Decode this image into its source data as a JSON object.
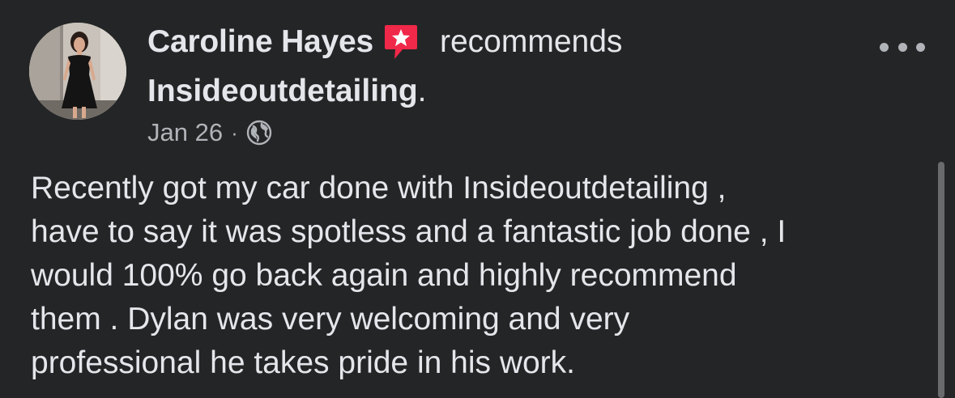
{
  "post": {
    "author_name": "Caroline Hayes",
    "action_verb": "recommends",
    "page_name": "Insideoutdetailing",
    "page_name_suffix": ".",
    "date": "Jan 26",
    "separator": "·",
    "privacy_icon": "globe-icon",
    "badge_icon": "recommendation-star-icon",
    "more_icon": "more-options-icon",
    "body": "Recently got my car done with Insideoutdetailing ,\nhave to say it was spotless and a fantastic job done , I\nwould 100% go back again and highly recommend\nthem . Dylan was very welcoming and very\nprofessional he takes pride in his work."
  },
  "colors": {
    "background": "#242526",
    "primary_text": "#e4e6eb",
    "secondary_text": "#b0b3b8",
    "badge": "#f02849"
  }
}
